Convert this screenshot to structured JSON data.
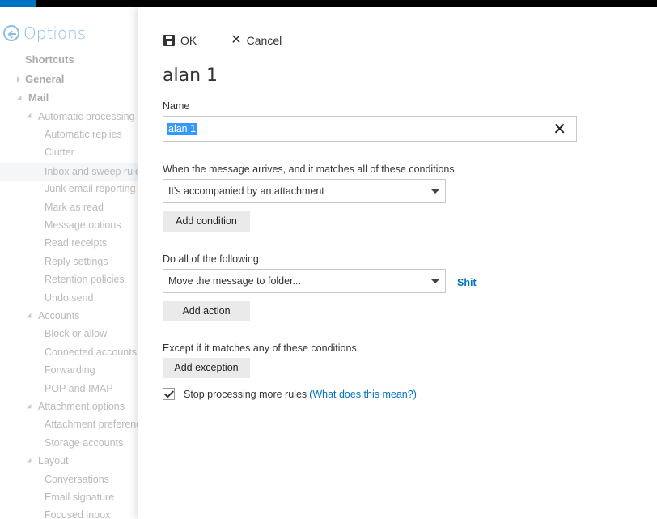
{
  "nav": {
    "title": "Options",
    "items": [
      {
        "label": "Shortcuts",
        "level": 0,
        "expander": "none"
      },
      {
        "label": "General",
        "level": 0,
        "expander": "right"
      },
      {
        "label": "Mail",
        "level": 0,
        "expander": "down"
      },
      {
        "label": "Automatic processing",
        "level": 1,
        "expander": "down"
      },
      {
        "label": "Automatic replies",
        "level": 2
      },
      {
        "label": "Clutter",
        "level": 2
      },
      {
        "label": "Inbox and sweep rules",
        "level": 2,
        "selected": true
      },
      {
        "label": "Junk email reporting",
        "level": 2
      },
      {
        "label": "Mark as read",
        "level": 2
      },
      {
        "label": "Message options",
        "level": 2
      },
      {
        "label": "Read receipts",
        "level": 2
      },
      {
        "label": "Reply settings",
        "level": 2
      },
      {
        "label": "Retention policies",
        "level": 2
      },
      {
        "label": "Undo send",
        "level": 2
      },
      {
        "label": "Accounts",
        "level": 1,
        "expander": "down"
      },
      {
        "label": "Block or allow",
        "level": 2
      },
      {
        "label": "Connected accounts",
        "level": 2
      },
      {
        "label": "Forwarding",
        "level": 2
      },
      {
        "label": "POP and IMAP",
        "level": 2
      },
      {
        "label": "Attachment options",
        "level": 1,
        "expander": "down"
      },
      {
        "label": "Attachment preferences",
        "level": 2
      },
      {
        "label": "Storage accounts",
        "level": 2
      },
      {
        "label": "Layout",
        "level": 1,
        "expander": "down"
      },
      {
        "label": "Conversations",
        "level": 2
      },
      {
        "label": "Email signature",
        "level": 2
      },
      {
        "label": "Focused inbox",
        "level": 2
      }
    ]
  },
  "toolbar": {
    "ok_label": "OK",
    "cancel_label": "Cancel"
  },
  "rule": {
    "title": "alan 1",
    "name_label": "Name",
    "name_value": "alan 1",
    "conditions_label": "When the message arrives, and it matches all of these conditions",
    "condition_value": "It's accompanied by an attachment",
    "add_condition_label": "Add condition",
    "actions_label": "Do all of the following",
    "action_value": "Move the message to folder...",
    "action_folder": "Shit",
    "add_action_label": "Add action",
    "exceptions_label": "Except if it matches any of these conditions",
    "add_exception_label": "Add exception",
    "stop_processing_label": "Stop processing more rules",
    "stop_processing_checked": true,
    "help_link_label": "(What does this mean?)"
  },
  "colors": {
    "accent": "#0072c6",
    "selection": "#3399ff"
  }
}
